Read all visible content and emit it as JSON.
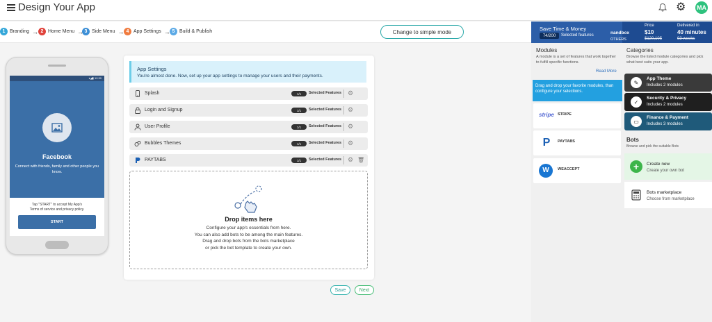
{
  "header": {
    "title": "Design Your App",
    "avatar_initials": "MA"
  },
  "steps": [
    {
      "num": "1",
      "label": "Branding",
      "color": "#35a7d9"
    },
    {
      "num": "2",
      "label": "Home Menu",
      "color": "#e0433c"
    },
    {
      "num": "3",
      "label": "Side Menu",
      "color": "#3d8fd6"
    },
    {
      "num": "4",
      "label": "App Settings",
      "color": "#f07b3f"
    },
    {
      "num": "5",
      "label": "Build & Publish",
      "color": "#5aa9e6"
    }
  ],
  "simple_mode_label": "Change to simple mode",
  "preview": {
    "status_time": "12:30",
    "app_name": "Facebook",
    "description": "Connect with friends, family and other people you know.",
    "tap_text_1": "Tap \"START\" to accept My App's",
    "tap_text_2": "Terms of service and privacy policy.",
    "start_label": "START"
  },
  "settings": {
    "title": "App Settings",
    "subtitle": "You're almost done. Now, set up your app settings to manage your users and their payments.",
    "features": [
      {
        "name": "Splash",
        "badge": "1/1",
        "selected": "Selected Features",
        "icon": "phone-icon"
      },
      {
        "name": "Login and Signup",
        "badge": "1/1",
        "selected": "Selected Features",
        "icon": "lock-icon"
      },
      {
        "name": "User Profile",
        "badge": "1/1",
        "selected": "Selected Features",
        "icon": "user-icon"
      },
      {
        "name": "Bubbles Themes",
        "badge": "1/1",
        "selected": "Selected Features",
        "icon": "bubbles-icon"
      },
      {
        "name": "PAYTABS",
        "badge": "1/1",
        "selected": "Selected Features",
        "icon": "paytabs-icon"
      }
    ],
    "drop": {
      "title": "Drop items here",
      "line1": "Configure your app's essentials from here.",
      "line2": "You can also add bots to be among the main features.",
      "line3": "Drag and drop bots from the bots marketplace",
      "line4": "or pick the bot template to create your own."
    },
    "save_label": "Save",
    "next_label": "Next"
  },
  "promo": {
    "title": "Save Time & Money",
    "count": "74/200",
    "selected": "Selected features",
    "brand": "nandbox",
    "others": "OTHERS",
    "price_label": "Price",
    "price_value": "$10",
    "price_old": "$120,105",
    "delivered_label": "Delivered in",
    "delivered_value": "40 minutes",
    "delivered_old": "93 weeks"
  },
  "modules": {
    "title": "Modules",
    "description": "A module is a set of features that work together to fulfill specific functions.",
    "read_more": "Read More",
    "tip": "Drag and drop your favorite modules, than configure your selections.",
    "items": [
      {
        "logo": "stripe",
        "name": "STRIPE"
      },
      {
        "logo": "P",
        "name": "PAYTABS"
      },
      {
        "logo": "W",
        "name": "WEACCEPT"
      }
    ]
  },
  "categories": {
    "title": "Categories",
    "description": "Browse the listed module categories and pick what best suits your app.",
    "items": [
      {
        "name": "App Theme",
        "count": "Includes 2 modules",
        "bg": "#3a3a3a"
      },
      {
        "name": "Security & Privacy",
        "count": "Includes 2 modules",
        "bg": "#1f1f1f"
      },
      {
        "name": "Finance & Payment",
        "count": "Includes 3 modules",
        "bg": "#1f5a7a"
      }
    ]
  },
  "bots": {
    "title": "Bots",
    "description": "Browse and pick the suitable Bots",
    "items": [
      {
        "title": "Create new",
        "subtitle": "Create your own bot",
        "bg": "#e4f6e6"
      },
      {
        "title": "Bots marketplace",
        "subtitle": "Choose from marketplace",
        "bg": "#ffffff"
      }
    ]
  }
}
